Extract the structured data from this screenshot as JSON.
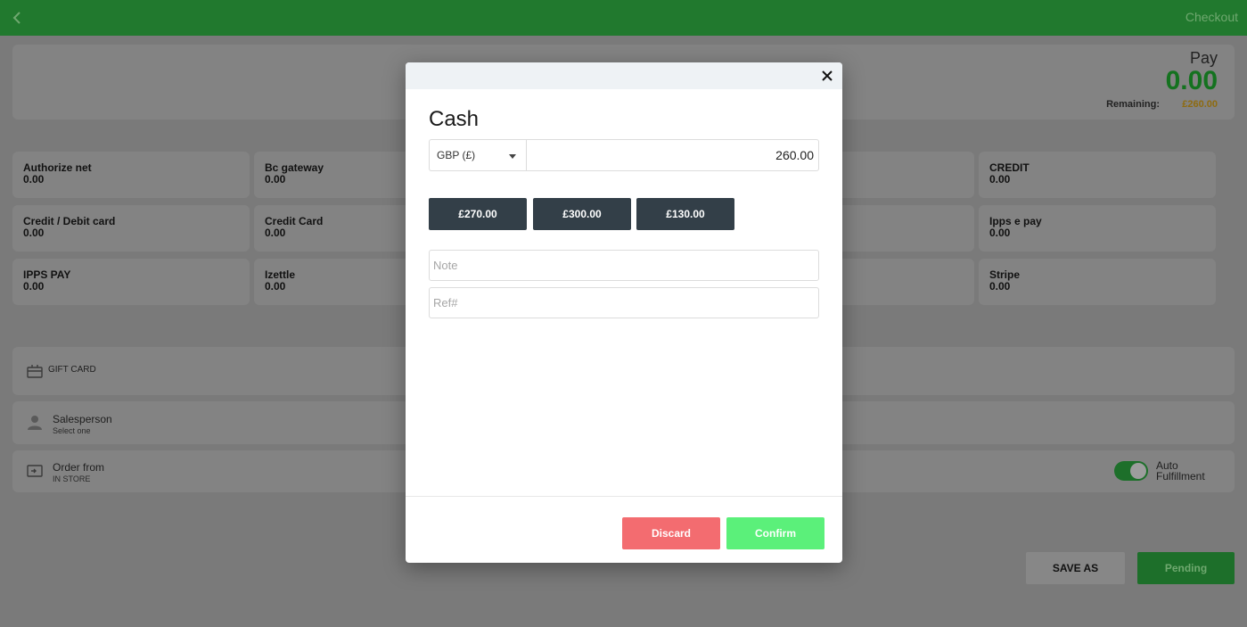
{
  "topbar": {
    "title": "Checkout",
    "back_icon": "chevron-left-icon"
  },
  "pay": {
    "label": "Pay",
    "amount": "0.00",
    "remaining_label": "Remaining:",
    "remaining_value": "£260.00"
  },
  "methods": [
    {
      "name": "Authorize net",
      "value": "0.00"
    },
    {
      "name": "Bc gateway",
      "value": "0.00"
    },
    {
      "name": "CREDIT",
      "value": "0.00"
    },
    {
      "name": "Credit / Debit card",
      "value": "0.00"
    },
    {
      "name": "Credit Card",
      "value": "0.00"
    },
    {
      "name": "Ipps e pay",
      "value": "0.00"
    },
    {
      "name": "IPPS PAY",
      "value": "0.00"
    },
    {
      "name": "Izettle",
      "value": "0.00"
    },
    {
      "name": "Stripe",
      "value": "0.00"
    }
  ],
  "giftcard": {
    "label": "GIFT CARD",
    "icon": "gift-card-icon"
  },
  "salesperson": {
    "label": "Salesperson",
    "sub": "Select one",
    "icon": "person-icon"
  },
  "order_from": {
    "label": "Order from",
    "sub": "IN STORE",
    "icon": "store-icon"
  },
  "auto_fulfillment": {
    "label_line1": "Auto",
    "label_line2": "Fulfillment",
    "enabled": true
  },
  "footer": {
    "save_as": "SAVE AS",
    "pending": "Pending"
  },
  "modal": {
    "title": "Cash",
    "currency": "GBP (£)",
    "amount": "260.00",
    "quick_amounts": [
      "£270.00",
      "£300.00",
      "£130.00"
    ],
    "note_placeholder": "Note",
    "ref_placeholder": "Ref#",
    "discard": "Discard",
    "confirm": "Confirm"
  },
  "colors": {
    "primary_green": "#21792e",
    "discard": "#f36c70",
    "confirm": "#5bf07a",
    "quick_button": "#333f48"
  }
}
